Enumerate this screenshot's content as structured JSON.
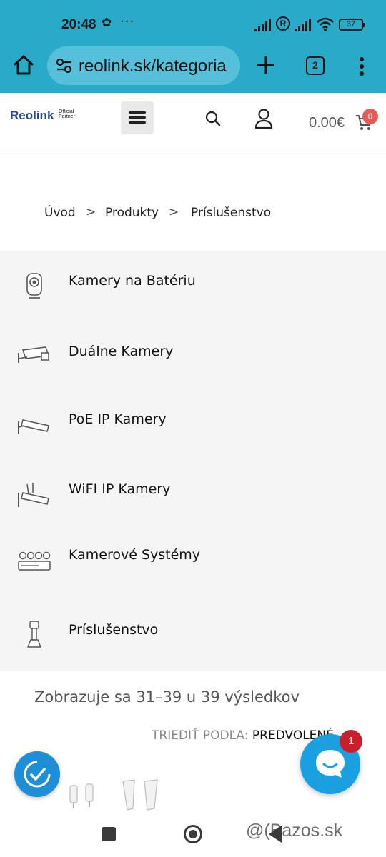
{
  "status_bar": {
    "time": "20:48",
    "notification_icon": "flower-icon",
    "more_indicator": "···",
    "roaming_badge": "R",
    "battery_level": "37"
  },
  "browser": {
    "url": "reolink.sk/kategoria",
    "tab_count": "2"
  },
  "header": {
    "logo_text": "Reolink",
    "logo_tagline_1": "Official",
    "logo_tagline_2": "Partner",
    "cart_total": "0.00€",
    "cart_count": "0"
  },
  "breadcrumb": {
    "items": [
      "Úvod",
      "Produkty",
      "Príslušenstvo"
    ],
    "separator": ">"
  },
  "categories": [
    {
      "label": "Kamery na Batériu",
      "icon": "battery-camera-icon"
    },
    {
      "label": "Duálne Kamery",
      "icon": "dual-camera-icon"
    },
    {
      "label": "PoE IP Kamery",
      "icon": "poe-camera-icon"
    },
    {
      "label": "WiFI IP Kamery",
      "icon": "wifi-camera-icon"
    },
    {
      "label": "Kamerové Systémy",
      "icon": "camera-system-icon"
    },
    {
      "label": "Príslušenstvo",
      "icon": "accessory-mount-icon"
    }
  ],
  "results_text": "Zobrazuje sa 31–39 u 39 výsledkov",
  "sort": {
    "label": "TRIEDIŤ PODĽA:",
    "value": "PREDVOLENÉ"
  },
  "chat": {
    "badge": "1"
  },
  "watermark": "@(Bazos.sk",
  "colors": {
    "browser_bar": "#2aaac9",
    "url_pill": "#56c0da",
    "category_bg": "#f5f5f6",
    "cart_badge": "#e65b57",
    "chat_button": "#1aa0e0",
    "chat_badge": "#c8202b",
    "accessibility_button": "#1e8fd6"
  }
}
